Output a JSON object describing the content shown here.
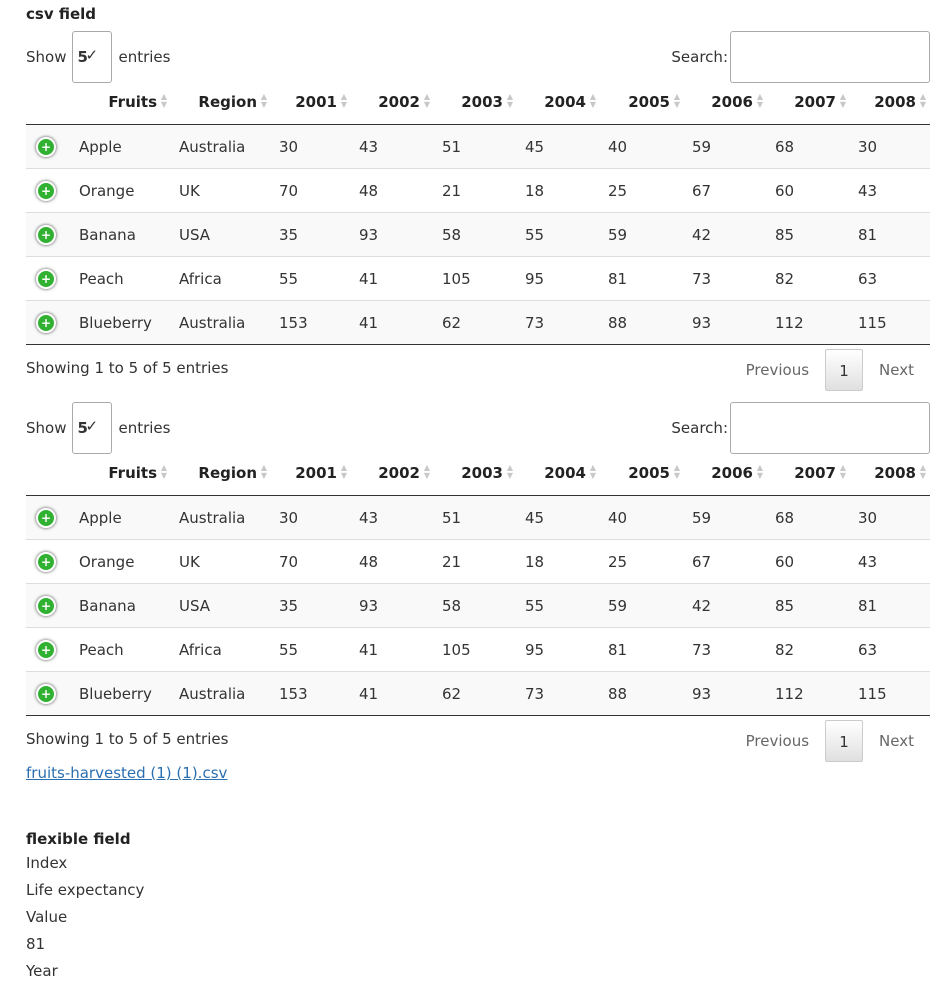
{
  "csv_field": {
    "label": "csv field",
    "tables": [
      {
        "show_label": "Show",
        "length_value": "5",
        "entries_label": "entries",
        "search_label": "Search:",
        "columns": [
          "Fruits",
          "Region",
          "2001",
          "2002",
          "2003",
          "2004",
          "2005",
          "2006",
          "2007",
          "2008"
        ],
        "rows": [
          [
            "Apple",
            "Australia",
            "30",
            "43",
            "51",
            "45",
            "40",
            "59",
            "68",
            "30"
          ],
          [
            "Orange",
            "UK",
            "70",
            "48",
            "21",
            "18",
            "25",
            "67",
            "60",
            "43"
          ],
          [
            "Banana",
            "USA",
            "35",
            "93",
            "58",
            "55",
            "59",
            "42",
            "85",
            "81"
          ],
          [
            "Peach",
            "Africa",
            "55",
            "41",
            "105",
            "95",
            "81",
            "73",
            "82",
            "63"
          ],
          [
            "Blueberry",
            "Australia",
            "153",
            "41",
            "62",
            "73",
            "88",
            "93",
            "112",
            "115"
          ]
        ],
        "info": "Showing 1 to 5 of 5 entries",
        "previous": "Previous",
        "page": "1",
        "next": "Next"
      },
      {
        "show_label": "Show",
        "length_value": "5",
        "entries_label": "entries",
        "search_label": "Search:",
        "columns": [
          "Fruits",
          "Region",
          "2001",
          "2002",
          "2003",
          "2004",
          "2005",
          "2006",
          "2007",
          "2008"
        ],
        "rows": [
          [
            "Apple",
            "Australia",
            "30",
            "43",
            "51",
            "45",
            "40",
            "59",
            "68",
            "30"
          ],
          [
            "Orange",
            "UK",
            "70",
            "48",
            "21",
            "18",
            "25",
            "67",
            "60",
            "43"
          ],
          [
            "Banana",
            "USA",
            "35",
            "93",
            "58",
            "55",
            "59",
            "42",
            "85",
            "81"
          ],
          [
            "Peach",
            "Africa",
            "55",
            "41",
            "105",
            "95",
            "81",
            "73",
            "82",
            "63"
          ],
          [
            "Blueberry",
            "Australia",
            "153",
            "41",
            "62",
            "73",
            "88",
            "93",
            "112",
            "115"
          ]
        ],
        "info": "Showing 1 to 5 of 5 entries",
        "previous": "Previous",
        "page": "1",
        "next": "Next"
      }
    ],
    "file_link": "fruits-harvested (1) (1).csv"
  },
  "flexible_field": {
    "label": "flexible field",
    "lines": [
      "Index",
      "Life expectancy",
      "Value",
      "81",
      "Year"
    ]
  },
  "colors": {
    "expand_icon": "#31b131",
    "link": "#2a6fb0",
    "stripe": "#f9f9f9"
  },
  "icons": {
    "expand": "plus-circle-icon",
    "sort": "sort-both-icon",
    "select_check": "checkmark-icon"
  }
}
